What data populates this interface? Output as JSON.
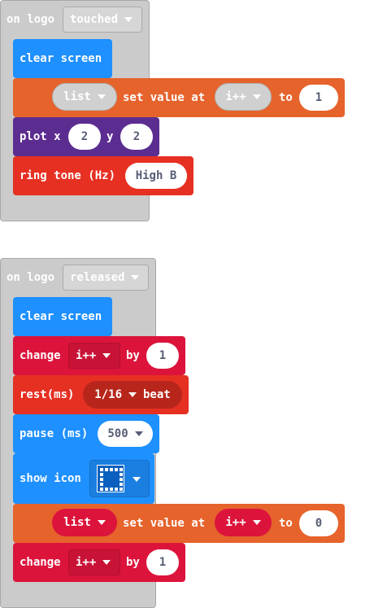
{
  "stack1": {
    "hat_label": "on logo",
    "hat_option": "touched",
    "clear_screen": "clear screen",
    "set_value": {
      "list_var": "list",
      "mid_text": "set value at",
      "index_var": "i++",
      "to_text": "to",
      "value": "1"
    },
    "plot": {
      "label": "plot x",
      "x": "2",
      "y_label": "y",
      "y": "2"
    },
    "ring_tone": {
      "label": "ring tone (Hz)",
      "note": "High B"
    }
  },
  "stack2": {
    "hat_label": "on logo",
    "hat_option": "released",
    "clear_screen": "clear screen",
    "change1": {
      "label": "change",
      "var": "i++",
      "by": "by",
      "value": "1"
    },
    "rest": {
      "label": "rest(ms)",
      "beat": "1/16",
      "beat_unit": "beat"
    },
    "pause": {
      "label": "pause (ms)",
      "value": "500"
    },
    "show_icon": {
      "label": "show icon"
    },
    "set_value": {
      "list_var": "list",
      "mid_text": "set value at",
      "index_var": "i++",
      "to_text": "to",
      "value": "0"
    },
    "change2": {
      "label": "change",
      "var": "i++",
      "by": "by",
      "value": "1"
    }
  },
  "colors": {
    "event_grey": "#cbcbcb",
    "basic_blue": "#1e90ff",
    "array_orange": "#e6632c",
    "led_purple": "#5c2d91",
    "music_red": "#e63022",
    "variable_red": "#dc143c",
    "value_white": "#ffffff"
  }
}
